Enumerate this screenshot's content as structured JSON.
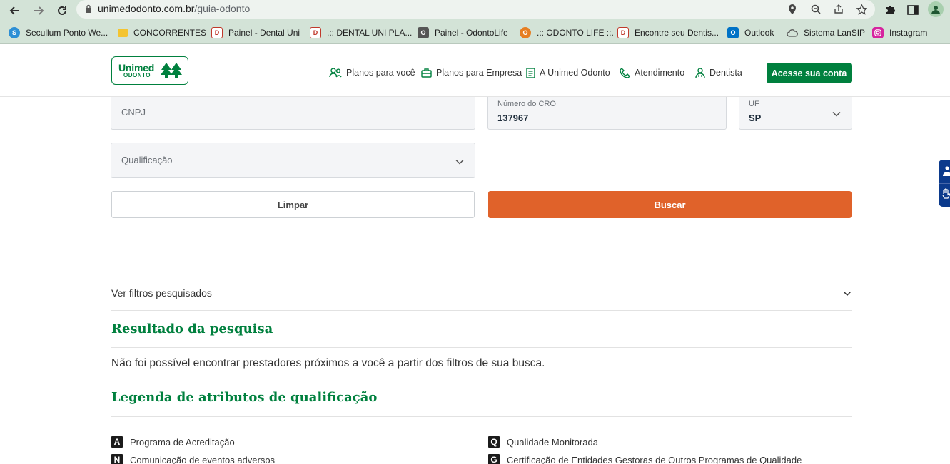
{
  "browser": {
    "url_host": "unimedodonto.com.br",
    "url_path": "/guia-odonto",
    "bookmarks": [
      {
        "label": "Secullum Ponto We...",
        "icon": "secullum-icon",
        "color": "#2d8fd5"
      },
      {
        "label": "CONCORRENTES",
        "icon": "folder-icon",
        "color": "#f4c430"
      },
      {
        "label": "Painel - Dental Uni",
        "icon": "dental-uni-icon",
        "color": "#c0392b"
      },
      {
        "label": ".:: DENTAL UNI PLA...",
        "icon": "dental-uni-icon",
        "color": "#c0392b"
      },
      {
        "label": "Painel - OdontoLife",
        "icon": "odontolife-icon",
        "color": "#555555"
      },
      {
        "label": ".:: ODONTO LIFE ::.",
        "icon": "odontolife-icon",
        "color": "#e67e22"
      },
      {
        "label": "Encontre seu Dentis...",
        "icon": "dental-uni-icon",
        "color": "#c0392b"
      },
      {
        "label": "Outlook",
        "icon": "outlook-icon",
        "color": "#0072c6"
      },
      {
        "label": "Sistema LanSIP",
        "icon": "cloud-icon",
        "color": "#777777"
      },
      {
        "label": "Instagram",
        "icon": "instagram-icon",
        "color": "#d6249f"
      }
    ]
  },
  "header": {
    "logo_top": "Unimed",
    "logo_bottom": "ODONTO",
    "nav": [
      {
        "label": "Planos para você",
        "icon": "people-icon"
      },
      {
        "label": "Planos para Empresa",
        "icon": "briefcase-icon"
      },
      {
        "label": "A Unimed Odonto",
        "icon": "document-icon"
      },
      {
        "label": "Atendimento",
        "icon": "phone-icon"
      },
      {
        "label": "Dentista",
        "icon": "dentist-icon"
      }
    ],
    "cta": "Acesse sua conta"
  },
  "form": {
    "cnpj_placeholder": "CNPJ",
    "cro_label": "Número do CRO",
    "cro_value": "137967",
    "uf_label": "UF",
    "uf_value": "SP",
    "qualificacao_placeholder": "Qualificação",
    "clear_label": "Limpar",
    "search_label": "Buscar"
  },
  "results": {
    "filters_toggle": "Ver filtros pesquisados",
    "title": "Resultado da pesquisa",
    "message": "Não foi possível encontrar prestadores próximos a você a partir dos filtros de sua busca."
  },
  "legend": {
    "title": "Legenda de atributos de qualificação",
    "items": [
      {
        "badge": "A",
        "label": "Programa de Acreditação"
      },
      {
        "badge": "Q",
        "label": "Qualidade Monitorada"
      },
      {
        "badge": "N",
        "label": "Comunicação de eventos adversos"
      },
      {
        "badge": "G",
        "label": "Certificação de Entidades Gestoras de Outros Programas de Qualidade"
      }
    ]
  },
  "colors": {
    "brand_green": "#00803e",
    "search_orange": "#e0622a",
    "accessibility_blue": "#0b3a8c"
  }
}
